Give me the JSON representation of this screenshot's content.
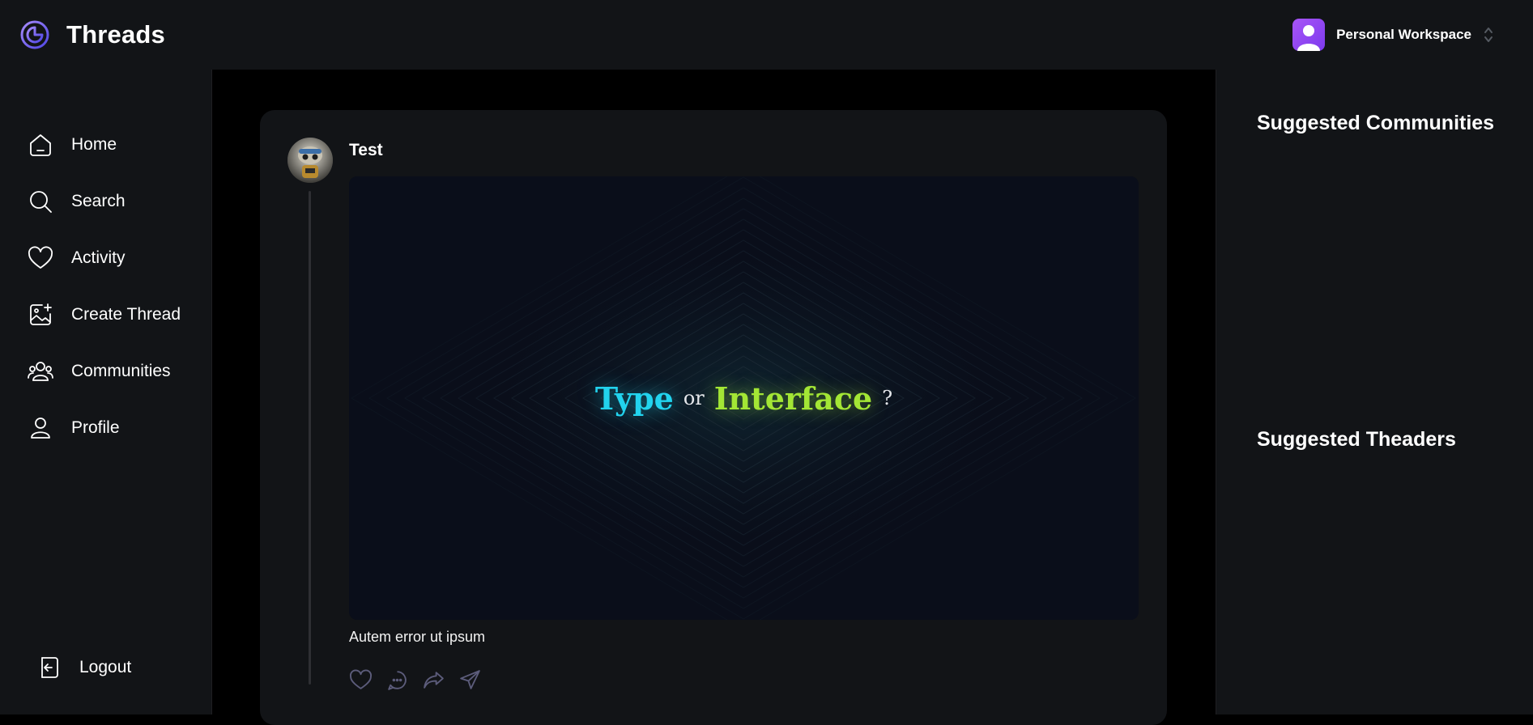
{
  "app": {
    "title": "Threads",
    "accent": "#877eff"
  },
  "workspace": {
    "name": "Personal Workspace",
    "avatar_color": "#a855f7"
  },
  "sidebar": {
    "items": [
      {
        "label": "Home",
        "icon": "home-icon"
      },
      {
        "label": "Search",
        "icon": "search-icon"
      },
      {
        "label": "Activity",
        "icon": "heart-icon"
      },
      {
        "label": "Create Thread",
        "icon": "image-plus-icon"
      },
      {
        "label": "Communities",
        "icon": "users-icon"
      },
      {
        "label": "Profile",
        "icon": "user-icon"
      }
    ],
    "logout_label": "Logout"
  },
  "thread": {
    "author": "Test",
    "image": {
      "word1": "Type",
      "word2": "or",
      "word3": "Interface",
      "word4": "?"
    },
    "text": "Autem error ut ipsum",
    "actions": [
      "heart-icon",
      "reply-icon",
      "repost-icon",
      "share-icon"
    ]
  },
  "rightbar": {
    "communities_title": "Suggested Communities",
    "threaders_title": "Suggested Theaders"
  }
}
